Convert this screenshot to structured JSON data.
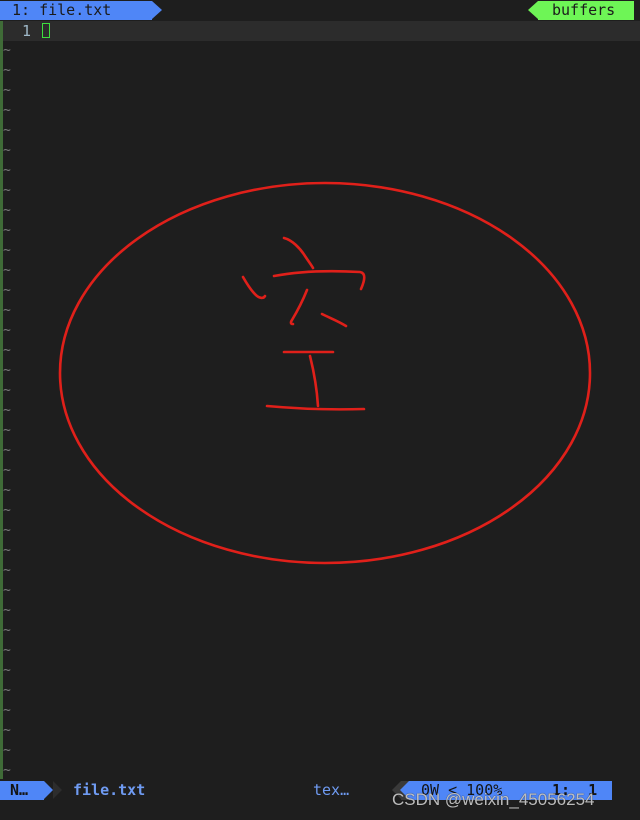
{
  "tabline": {
    "active_tab": "1: file.txt",
    "buffers_label": "buffers"
  },
  "editor": {
    "line_number": "1",
    "tilde": "~",
    "empty_line_count": 37
  },
  "annotation": {
    "text": "空",
    "color": "#e0201a"
  },
  "statusline": {
    "mode": "N…",
    "filename": "file.txt",
    "filetype": "tex…",
    "info": "0W < 100%",
    "position": "1:  1"
  },
  "watermark": "CSDN @weixin_45056254",
  "colors": {
    "background": "#1e1e1e",
    "accent_blue": "#4f86f7",
    "accent_green": "#6ef556",
    "cursor_green": "#3ee03e"
  }
}
